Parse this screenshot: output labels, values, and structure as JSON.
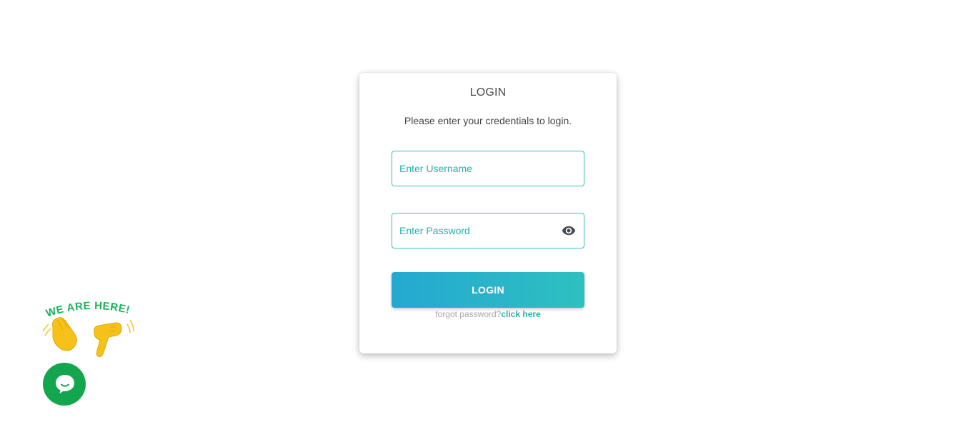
{
  "login_card": {
    "title": "LOGIN",
    "subtitle": "Please enter your credentials to login.",
    "username_placeholder": "Enter Username",
    "username_value": "",
    "password_placeholder": "Enter Password",
    "password_value": "",
    "password_toggle_icon": "eye-icon",
    "login_button_label": "LOGIN",
    "forgot_text": "forgot password?",
    "forgot_link_label": "click here"
  },
  "chat_widget": {
    "badge_text": "WE ARE HERE!",
    "badge_icons": [
      "waving-hand-icon",
      "pointing-hand-icon"
    ],
    "chat_icon": "chat-bubble-icon"
  },
  "colors": {
    "accent": "#22b3ad",
    "button_gradient_start": "#24a8d2",
    "button_gradient_end": "#2ec0c0",
    "chat_green": "#14a64f",
    "hand_yellow": "#f6c21a"
  }
}
